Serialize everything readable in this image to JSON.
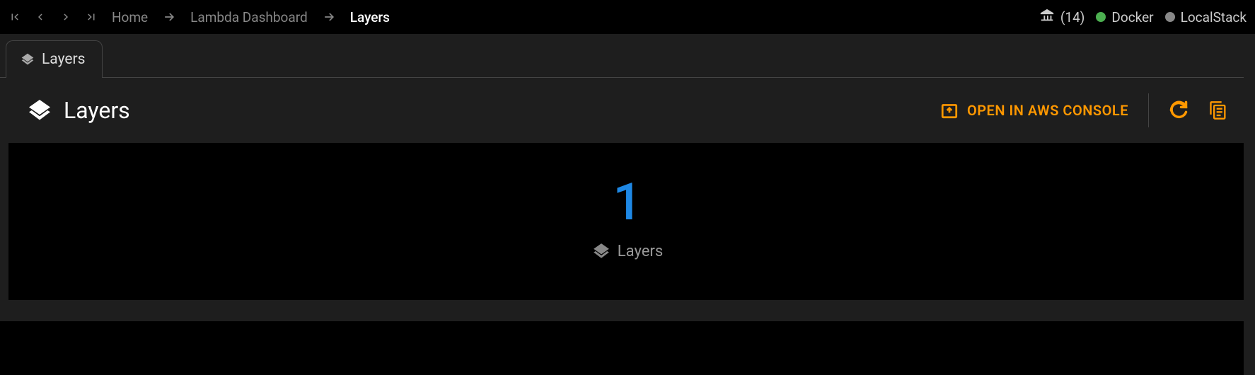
{
  "breadcrumbs": {
    "home": "Home",
    "dashboard": "Lambda Dashboard",
    "current": "Layers"
  },
  "status": {
    "count": "(14)",
    "docker": "Docker",
    "localstack": "LocalStack"
  },
  "tab": {
    "label": "Layers"
  },
  "header": {
    "title": "Layers",
    "aws_console": "OPEN IN AWS CONSOLE"
  },
  "stats": {
    "count": "1",
    "label": "Layers"
  }
}
